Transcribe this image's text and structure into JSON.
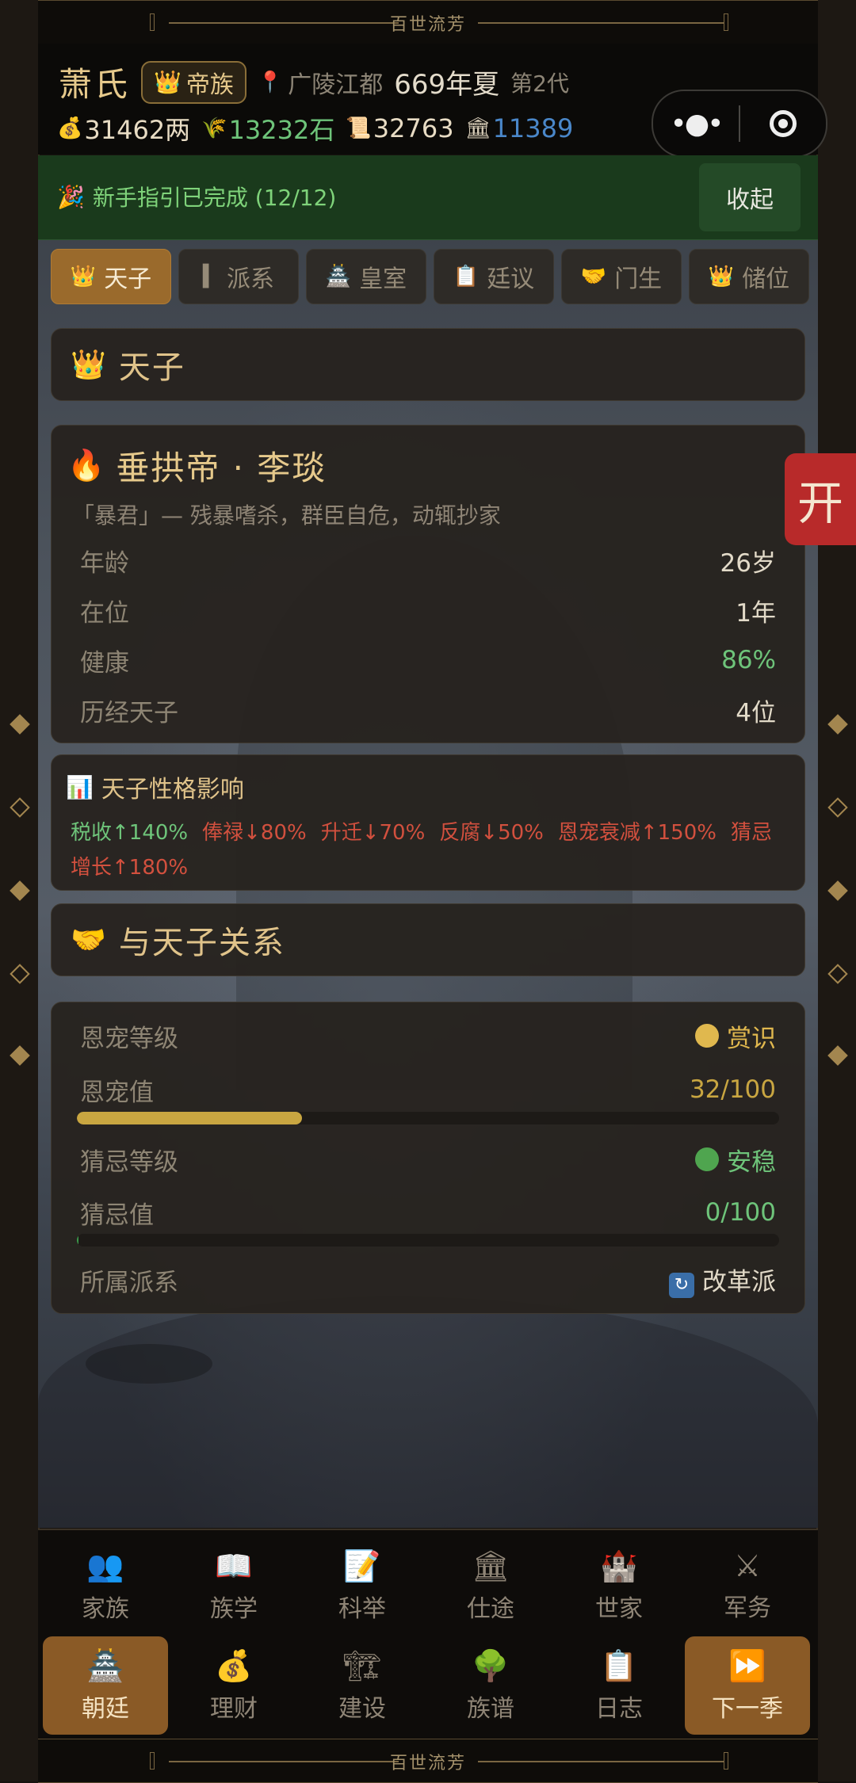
{
  "banner": {
    "title": "百世流芳"
  },
  "header": {
    "clan_name": "萧氏",
    "rank_icon": "crown-icon",
    "rank_label": "帝族",
    "location": "广陵江都",
    "year": "669年夏",
    "generation": "第2代",
    "resources": [
      {
        "icon": "money-bag-icon",
        "value": "31462两",
        "color": "#e8dcc4"
      },
      {
        "icon": "grain-icon",
        "value": "13232石",
        "color": "#6ec47a"
      },
      {
        "icon": "scroll-icon",
        "value": "32763",
        "color": "#e8dcc4"
      },
      {
        "icon": "bank-icon",
        "value": "11389",
        "color": "#4a87c9"
      }
    ]
  },
  "guide": {
    "text": "新手指引已完成 (12/12)",
    "collapse_label": "收起"
  },
  "tabs": [
    {
      "icon": "👑",
      "label": "天子",
      "active": true
    },
    {
      "icon": "▍",
      "label": "派系"
    },
    {
      "icon": "🏯",
      "label": "皇室"
    },
    {
      "icon": "📋",
      "label": "廷议"
    },
    {
      "icon": "🤝",
      "label": "门生"
    },
    {
      "icon": "👑",
      "label": "储位"
    }
  ],
  "emperor_section": {
    "title": "天子"
  },
  "emperor": {
    "name": "垂拱帝 · 李琰",
    "trait": "「暴君」— 残暴嗜杀，群臣自危，动辄抄家",
    "age_label": "年龄",
    "age": "26岁",
    "reign_label": "在位",
    "reign": "1年",
    "health_label": "健康",
    "health": "86%",
    "prior_label": "历经天子",
    "prior": "4位"
  },
  "impact": {
    "title": "天子性格影响",
    "effects": [
      {
        "text": "税收↑140%",
        "kind": "up"
      },
      {
        "text": "俸禄↓80%",
        "kind": "down"
      },
      {
        "text": "升迁↓70%",
        "kind": "down"
      },
      {
        "text": "反腐↓50%",
        "kind": "down"
      },
      {
        "text": "恩宠衰减↑150%",
        "kind": "down"
      },
      {
        "text": "猜忌增长↑180%",
        "kind": "down"
      }
    ]
  },
  "relation_section": {
    "title": "与天子关系"
  },
  "relation": {
    "favor_level_label": "恩宠等级",
    "favor_level": "赏识",
    "favor_color": "#e0b84e",
    "favor_value_label": "恩宠值",
    "favor_value": "32/100",
    "favor_fraction": 0.32,
    "suspicion_level_label": "猜忌等级",
    "suspicion_level": "安稳",
    "suspicion_color": "#4fa54f",
    "suspicion_value_label": "猜忌值",
    "suspicion_value": "0/100",
    "suspicion_fraction": 0,
    "faction_label": "所属派系",
    "faction": "改革派"
  },
  "side_tab": {
    "label": "开"
  },
  "nav": {
    "row1": [
      {
        "icon": "👥",
        "label": "家族"
      },
      {
        "icon": "📖",
        "label": "族学"
      },
      {
        "icon": "📝",
        "label": "科举"
      },
      {
        "icon": "🏛",
        "label": "仕途"
      },
      {
        "icon": "🏰",
        "label": "世家"
      },
      {
        "icon": "⚔",
        "label": "军务"
      }
    ],
    "row2": [
      {
        "icon": "🏯",
        "label": "朝廷",
        "active": true
      },
      {
        "icon": "💰",
        "label": "理财"
      },
      {
        "icon": "🏗",
        "label": "建设"
      },
      {
        "icon": "🌳",
        "label": "族谱"
      },
      {
        "icon": "📋",
        "label": "日志"
      },
      {
        "icon": "⏩",
        "label": "下一季",
        "active": true
      }
    ]
  }
}
